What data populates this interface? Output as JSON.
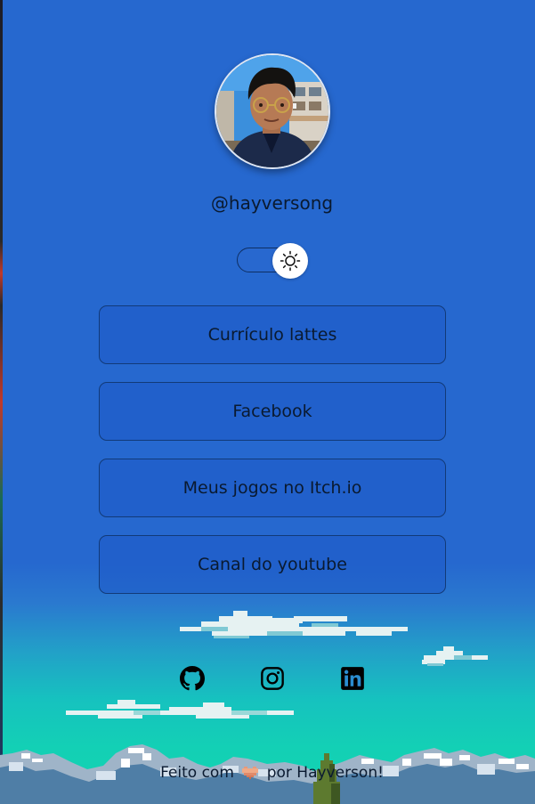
{
  "profile": {
    "handle": "@hayversong"
  },
  "theme_toggle": {
    "icon": "sun-icon"
  },
  "links": [
    {
      "label": "Currículo lattes"
    },
    {
      "label": "Facebook"
    },
    {
      "label": "Meus jogos no Itch.io"
    },
    {
      "label": "Canal do youtube"
    }
  ],
  "social": [
    {
      "icon": "github-icon"
    },
    {
      "icon": "instagram-icon"
    },
    {
      "icon": "linkedin-icon"
    }
  ],
  "footer": {
    "prefix": "Feito com",
    "suffix": "por Hayverson!"
  },
  "colors": {
    "background": "#2668cf",
    "button_border": "#123a78",
    "text": "#0a1a30"
  }
}
